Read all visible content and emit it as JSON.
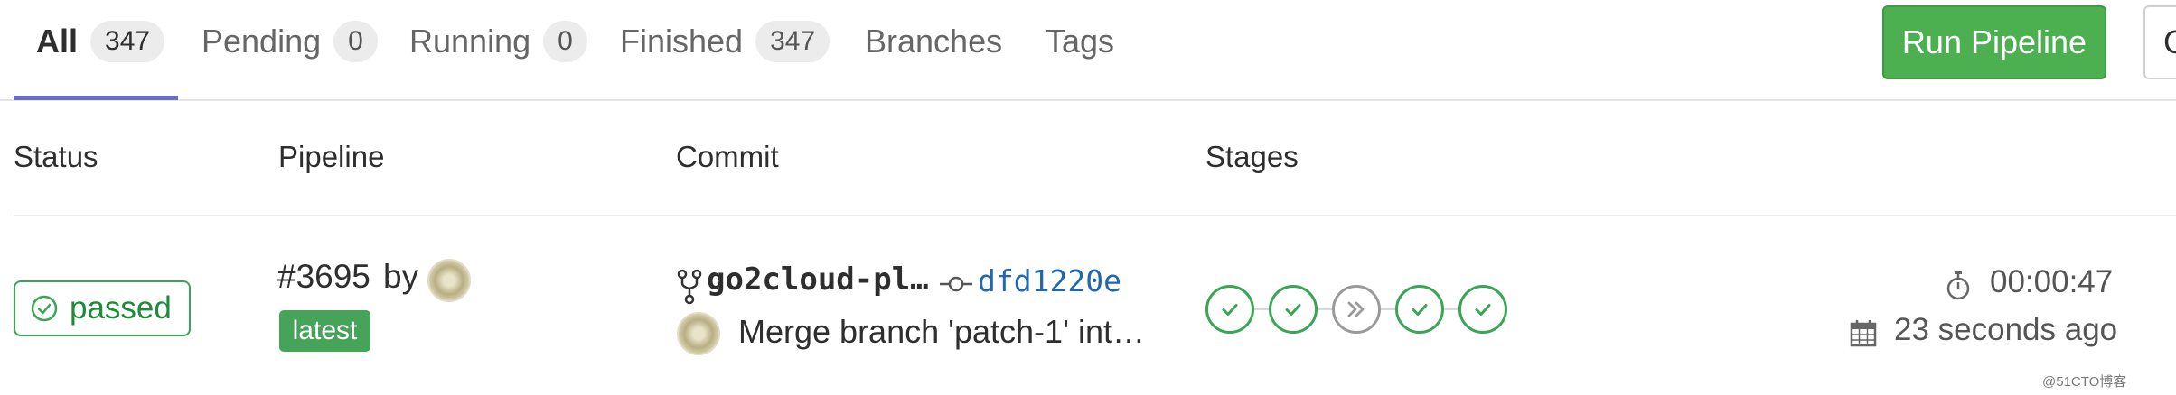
{
  "tabs": [
    {
      "label": "All",
      "count": "347"
    },
    {
      "label": "Pending",
      "count": "0"
    },
    {
      "label": "Running",
      "count": "0"
    },
    {
      "label": "Finished",
      "count": "347"
    },
    {
      "label": "Branches"
    },
    {
      "label": "Tags"
    }
  ],
  "actions": {
    "run_pipeline": "Run Pipeline",
    "clear_cache_partial": "C"
  },
  "columns": {
    "status": "Status",
    "pipeline": "Pipeline",
    "commit": "Commit",
    "stages": "Stages"
  },
  "pipeline": {
    "status": "passed",
    "id": "#3695",
    "by": "by",
    "tag": "latest",
    "branch": "go2cloud-pl…",
    "sha": "dfd1220e",
    "message": "Merge branch 'patch-1' int…",
    "stages": [
      "success",
      "success",
      "skipped",
      "success",
      "success"
    ],
    "duration": "00:00:47",
    "finished_ago": "23 seconds ago"
  },
  "watermark": "@51CTO博客",
  "colors": {
    "success": "#3aa655",
    "accent": "#6b6ebc",
    "link": "#1f67b1",
    "run_button": "#4caf50"
  }
}
